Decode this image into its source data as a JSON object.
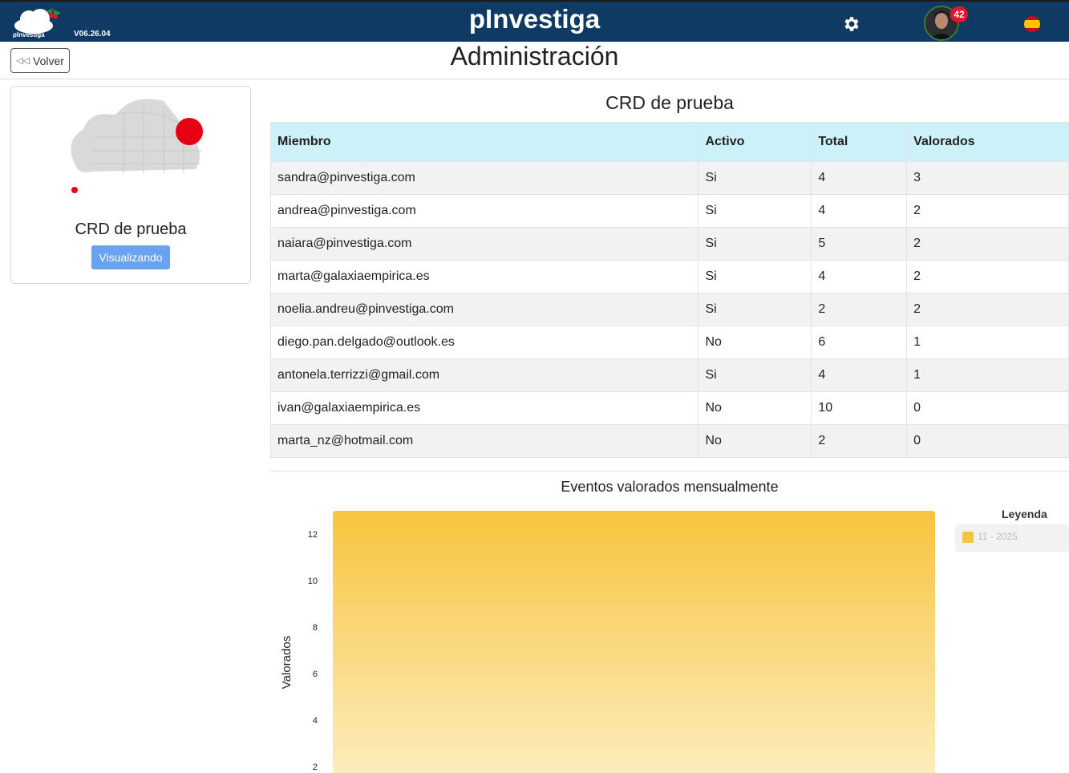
{
  "header": {
    "logo_text": "pInvestiga",
    "version": "V06.26.04",
    "app_title": "pInvestiga",
    "notification_count": "42"
  },
  "toolbar": {
    "back_label": "Volver",
    "page_title": "Administración"
  },
  "card": {
    "title": "CRD de prueba",
    "status_button": "Visualizando"
  },
  "table": {
    "title": "CRD de prueba",
    "columns": [
      "Miembro",
      "Activo",
      "Total",
      "Valorados"
    ],
    "rows": [
      [
        "sandra@pinvestiga.com",
        "Si",
        "4",
        "3"
      ],
      [
        "andrea@pinvestiga.com",
        "Si",
        "4",
        "2"
      ],
      [
        "naiara@pinvestiga.com",
        "Si",
        "5",
        "2"
      ],
      [
        "marta@galaxiaempirica.es",
        "Si",
        "4",
        "2"
      ],
      [
        "noelia.andreu@pinvestiga.com",
        "Si",
        "2",
        "2"
      ],
      [
        "diego.pan.delgado@outlook.es",
        "No",
        "6",
        "1"
      ],
      [
        "antonela.terrizzi@gmail.com",
        "Si",
        "4",
        "1"
      ],
      [
        "ivan@galaxiaempirica.es",
        "No",
        "10",
        "0"
      ],
      [
        "marta_nz@hotmail.com",
        "No",
        "2",
        "0"
      ]
    ]
  },
  "colors": {
    "topbar": "#0f3a63",
    "table_header": "#cdf1f8",
    "button": "#6aa2f2",
    "bar": "#f7c43d",
    "badge": "#e4152a"
  },
  "chart_data": {
    "type": "bar",
    "title": "Eventos valorados mensualmente",
    "ylabel": "Valorados",
    "xlabel": "",
    "categories": [
      "11 - 2025"
    ],
    "series": [
      {
        "name": "11 - 2025",
        "values": [
          13
        ]
      }
    ],
    "yticks": [
      2,
      4,
      6,
      8,
      10,
      12
    ],
    "ylim": [
      0,
      13
    ],
    "grid": true,
    "legend_title": "Leyenda",
    "legend_position": "right"
  }
}
